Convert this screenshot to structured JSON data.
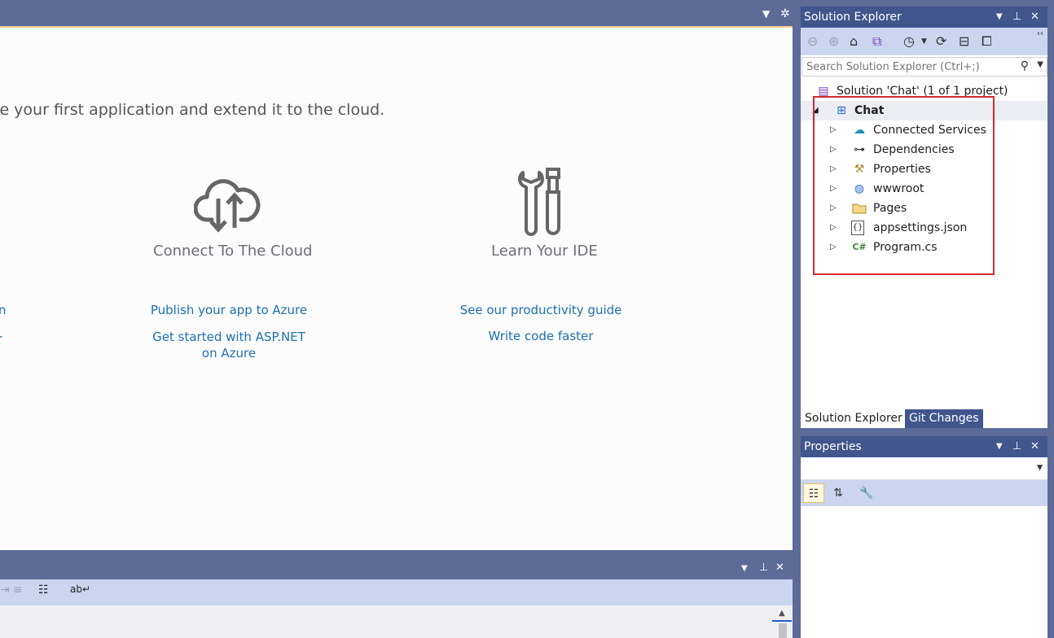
{
  "start_page": {
    "intro_text": "te your first application and extend it to the cloud.",
    "features": [
      {
        "title": "Connect To The Cloud",
        "icon": "cloud-upload-download-icon"
      },
      {
        "title": "Learn Your IDE",
        "icon": "tools-icon"
      }
    ],
    "links": {
      "left_cut_1": "n",
      "left_cut_2": "-",
      "publish_azure": "Publish your app to Azure",
      "aspnet_azure": "Get started with ASP.NET on Azure",
      "productivity": "See our productivity guide",
      "write_faster": "Write code faster"
    }
  },
  "solution_explorer": {
    "title": "Solution Explorer",
    "search_placeholder": "Search Solution Explorer (Ctrl+;)",
    "solution_label": "Solution 'Chat' (1 of 1 project)",
    "project_label": "Chat",
    "items": [
      {
        "label": "Connected Services",
        "icon": "connected-services-icon"
      },
      {
        "label": "Dependencies",
        "icon": "dependencies-icon"
      },
      {
        "label": "Properties",
        "icon": "properties-wrench-icon"
      },
      {
        "label": "wwwroot",
        "icon": "globe-icon"
      },
      {
        "label": "Pages",
        "icon": "folder-icon"
      },
      {
        "label": "appsettings.json",
        "icon": "json-file-icon"
      },
      {
        "label": "Program.cs",
        "icon": "csharp-file-icon"
      }
    ],
    "csharp_glyph": "C#",
    "json_glyph": "{}",
    "tabs": [
      "Solution Explorer",
      "Git Changes"
    ]
  },
  "properties_panel": {
    "title": "Properties"
  },
  "colors": {
    "chrome": "#5d6b99",
    "panel_title": "#40568d",
    "toolbar": "#ccd5f0",
    "link": "#1c6fb3",
    "highlight": "#d42a31"
  }
}
